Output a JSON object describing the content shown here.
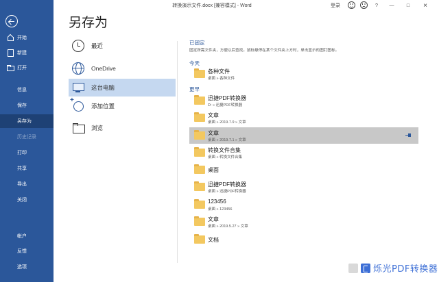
{
  "window": {
    "title": "转换演示文件.docx [兼容模式] - Word",
    "login": "登录",
    "help": "?",
    "minimize": "—",
    "restore": "□",
    "close": "×"
  },
  "sidebar": {
    "items": [
      {
        "label": "开始",
        "icon": "home-icon"
      },
      {
        "label": "新建",
        "icon": "new-document-icon"
      },
      {
        "label": "打开",
        "icon": "open-folder-icon"
      },
      {
        "label": "信息"
      },
      {
        "label": "保存"
      },
      {
        "label": "另存为",
        "active": true
      },
      {
        "label": "历史记录",
        "disabled": true
      },
      {
        "label": "打印"
      },
      {
        "label": "共享"
      },
      {
        "label": "导出"
      },
      {
        "label": "关闭"
      },
      {
        "label": "帐户"
      },
      {
        "label": "反馈"
      },
      {
        "label": "选项"
      }
    ],
    "colors": {
      "background": "#2b579a",
      "active": "#1e4175"
    }
  },
  "page_title": "另存为",
  "locations": [
    {
      "label": "最近",
      "icon": "clock-icon"
    },
    {
      "label": "OneDrive",
      "icon": "globe-icon"
    },
    {
      "label": "这台电脑",
      "icon": "computer-icon",
      "selected": true
    },
    {
      "label": "添加位置",
      "icon": "add-location-icon"
    },
    {
      "label": "浏览",
      "icon": "folder-icon"
    }
  ],
  "pinned": {
    "heading": "已固定",
    "description": "固定所需文件夹，方便以后查找。鼠标悬停在某个文件夹上方时，单击显示的图钉图标。"
  },
  "today": {
    "heading": "今天",
    "folders": [
      {
        "name": "各种文件",
        "path": "桌面 » 各种文件"
      }
    ]
  },
  "earlier": {
    "heading": "更早",
    "folders": [
      {
        "name": "迅捷PDF转换器",
        "path": "D: » 迅捷PDF转换器"
      },
      {
        "name": "文章",
        "path": "桌面 » 2019.7.9 » 文章"
      },
      {
        "name": "文章",
        "path": "桌面 » 2019.7.1 » 文章",
        "selected": true
      },
      {
        "name": "转换文件合集",
        "path": "桌面 » 转换文件合集"
      },
      {
        "name": "桌面",
        "path": ""
      },
      {
        "name": "迅捷PDF转换器",
        "path": "桌面 » 迅捷PDF转换器"
      },
      {
        "name": "123456",
        "path": "桌面 » 123456"
      },
      {
        "name": "文章",
        "path": "桌面 » 2019.5.27 » 文章"
      },
      {
        "name": "文档",
        "path": ""
      }
    ]
  },
  "watermark": {
    "text": "烁光PDF转换器"
  }
}
